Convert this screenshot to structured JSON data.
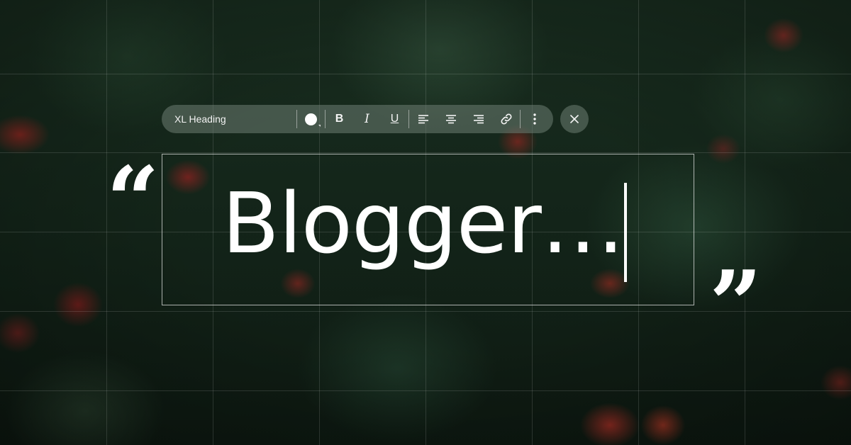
{
  "toolbar": {
    "text_style": "XL Heading",
    "text_color": "#ffffff",
    "buttons": [
      "color-picker",
      "bold",
      "italic",
      "underline",
      "align-left",
      "align-center",
      "align-right",
      "link",
      "more"
    ],
    "bold_label": "B",
    "italic_label": "I",
    "underline_label": "U"
  },
  "editor": {
    "heading": "Blogger…",
    "open_quote": "“",
    "close_quote": "”"
  },
  "colors": {
    "toolbar_bg": "#6e7d73",
    "text": "#ffffff",
    "background_foliage": "#1a3021",
    "accent_berries": "#aa2823"
  }
}
